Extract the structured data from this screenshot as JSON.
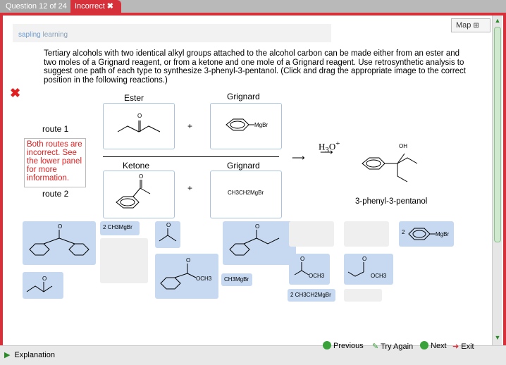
{
  "tabs": {
    "question": "Question 12 of 24",
    "status": "Incorrect"
  },
  "logo": {
    "part1": "sapling",
    "part2": "learning"
  },
  "map_label": "Map",
  "question_text": "Tertiary alcohols with two identical alkyl groups attached to the alcohol carbon can be made either from an ester and two moles of a Grignard reagent, or from a ketone and one mole of a Grignard reagent. Use retrosynthetic analysis to suggest one path of each type to synthesize 3-phenyl-3-pentanol. (Click and drag the appropriate image to the correct position in the following reactions.)",
  "headers": {
    "ester": "Ester",
    "grignard1": "Grignard",
    "ketone": "Ketone",
    "grignard2": "Grignard"
  },
  "routes": {
    "route1": "route 1",
    "route2": "route 2"
  },
  "plus": "+",
  "error_message": "Both routes are incorrect. See the lower panel for more information.",
  "reagent": "H3O+",
  "product_name": "3-phenyl-3-pentanol",
  "labels": {
    "mgbr": "MgBr",
    "ethyl_mgbr": "CH3CH2MgBr",
    "oh": "OH",
    "tile_2ch3mgbr": "2 CH3MgBr",
    "tile_ch3mgbr": "CH3MgBr",
    "tile_och3": "OCH3",
    "tile_2etmgbr": "2 CH3CH2MgBr",
    "tile_2": "2"
  },
  "footer": {
    "explanation": "Explanation",
    "previous": "Previous",
    "try_again": "Try Again",
    "next": "Next",
    "exit": "Exit"
  },
  "colors": {
    "accent": "#d6303a",
    "tile": "#c6d9f1",
    "error": "#e02020"
  }
}
